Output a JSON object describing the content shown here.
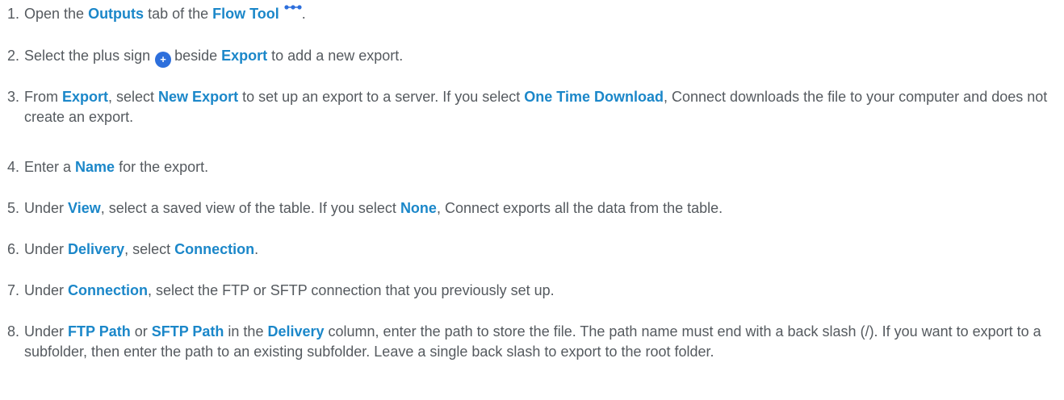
{
  "icons": {
    "flow_tool": "flow-tool-icon",
    "plus": "plus-circle-icon"
  },
  "colors": {
    "text": "#555a5f",
    "emphasis": "#1b87c9",
    "plus_icon": "#2d6fdc"
  },
  "steps": [
    {
      "number": "1.",
      "t1": "Open the ",
      "b1": "Outputs",
      "t2": " tab of the ",
      "b2": "Flow Tool",
      "t3": "."
    },
    {
      "number": "2.",
      "t1": "Select the plus sign",
      "plus_symbol": "+",
      "t2": "beside ",
      "b1": "Export",
      "t3": " to add a new export."
    },
    {
      "number": "3.",
      "t1": "From ",
      "b1": "Export",
      "t2": ", select ",
      "b2": "New Export",
      "t3": " to set up an export to a server. If you select ",
      "b3": "One Time Download",
      "t4": ", Connect downloads the file to your computer and does not create an export."
    },
    {
      "number": "4.",
      "t1": "Enter a ",
      "b1": "Name",
      "t2": " for the export."
    },
    {
      "number": "5.",
      "t1": "Under ",
      "b1": "View",
      "t2": ", select a saved view of the table. If you select ",
      "b2": "None",
      "t3": ", Connect exports all the data from the table."
    },
    {
      "number": "6.",
      "t1": "Under ",
      "b1": "Delivery",
      "t2": ", select ",
      "b2": "Connection",
      "t3": "."
    },
    {
      "number": "7.",
      "t1": "Under ",
      "b1": "Connection",
      "t2": ", select the FTP or SFTP connection that you previously set up."
    },
    {
      "number": "8.",
      "t1": "Under ",
      "b1": "FTP Path",
      "t2": " or ",
      "b2": "SFTP Path",
      "t3": " in the ",
      "b3": "Delivery",
      "t4": " column, enter the path to store the file. The path name must end with a back slash (/). If you want to export to a subfolder, then enter the path to an existing subfolder. Leave a single back slash to export to the root folder."
    }
  ]
}
